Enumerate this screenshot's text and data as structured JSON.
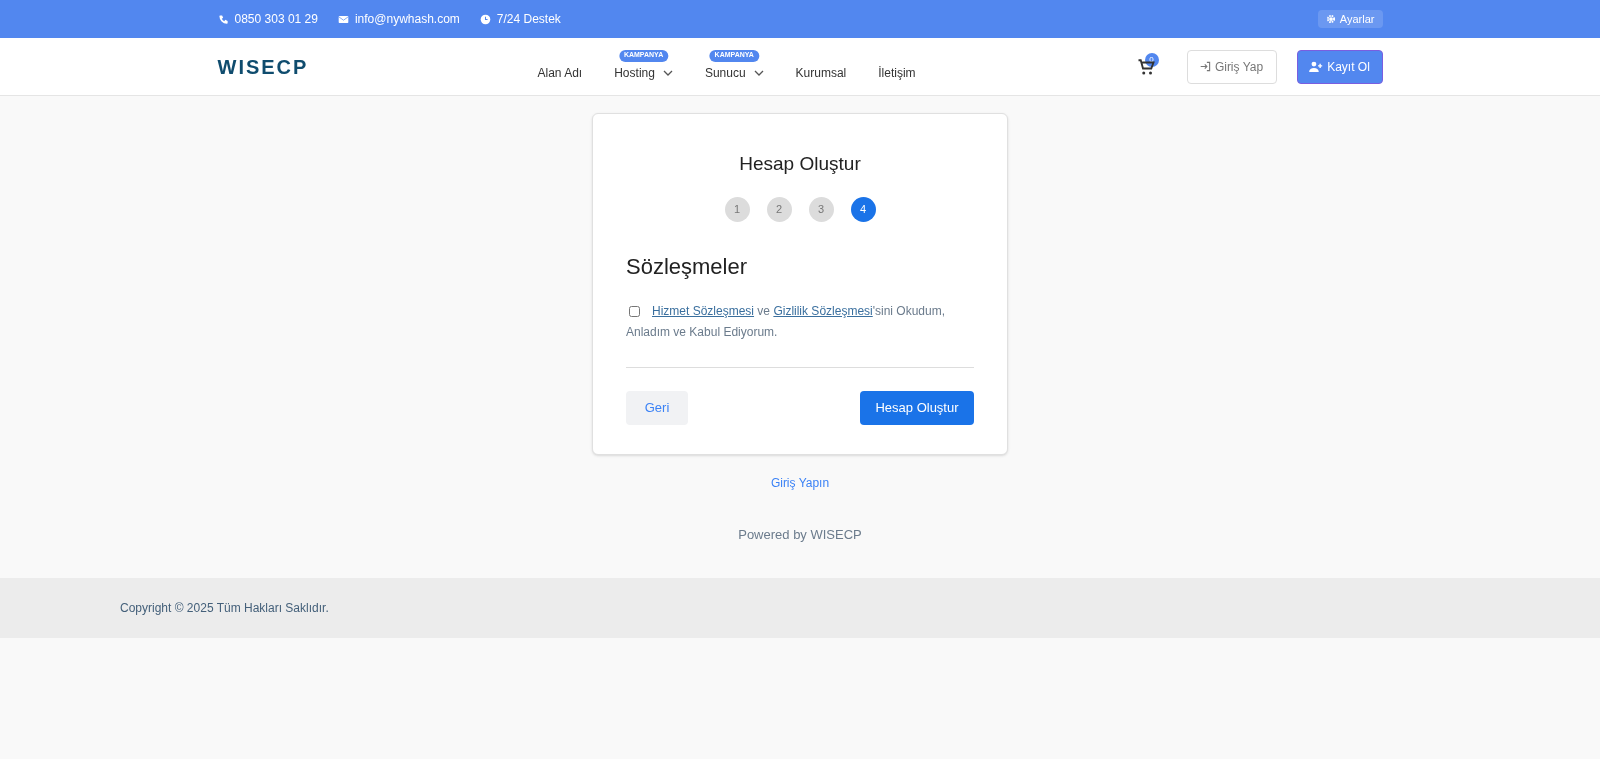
{
  "topbar": {
    "contacts": [
      {
        "kind": "phone",
        "text": "0850 303 01 29"
      },
      {
        "kind": "mail",
        "text": "info@nywhash.com"
      },
      {
        "kind": "clock",
        "text": "7/24 Destek"
      }
    ],
    "settings": "Ayarlar"
  },
  "header": {
    "logo": "WISECP",
    "nav": [
      {
        "label": "Alan Adı",
        "dropdown": false
      },
      {
        "label": "Hosting",
        "badge": "KAMPANYA",
        "dropdown": true
      },
      {
        "label": "Sunucu",
        "badge": "KAMPANYA",
        "dropdown": true
      },
      {
        "label": "Kurumsal",
        "dropdown": false
      },
      {
        "label": "İletişim",
        "dropdown": false
      }
    ],
    "cart_count": "0",
    "login": "Giriş Yap",
    "register": "Kayıt Ol"
  },
  "card": {
    "title": "Hesap Oluştur",
    "steps": [
      {
        "label": "1",
        "selected": false
      },
      {
        "label": "2",
        "selected": false
      },
      {
        "label": "3",
        "selected": false
      },
      {
        "label": "4",
        "selected": true
      }
    ],
    "section": "Sözleşmeler",
    "agreement": {
      "checked": false,
      "parts": [
        {
          "kind": "link",
          "text": "Hizmet Sözleşmesi"
        },
        {
          "kind": "text",
          "text": " ve "
        },
        {
          "kind": "link",
          "text": "Gizlilik Sözleşmesi"
        },
        {
          "kind": "text",
          "text": "'sini Okudum,"
        },
        {
          "kind": "next_line",
          "text": "Anladım ve Kabul Ediyorum."
        }
      ]
    },
    "back": "Geri",
    "submit": "Hesap Oluştur"
  },
  "login_link": "Giriş Yapın",
  "powered": "Powered by WISECP",
  "copyright": "Copyright © 2025 Tüm Hakları Saklıdır."
}
